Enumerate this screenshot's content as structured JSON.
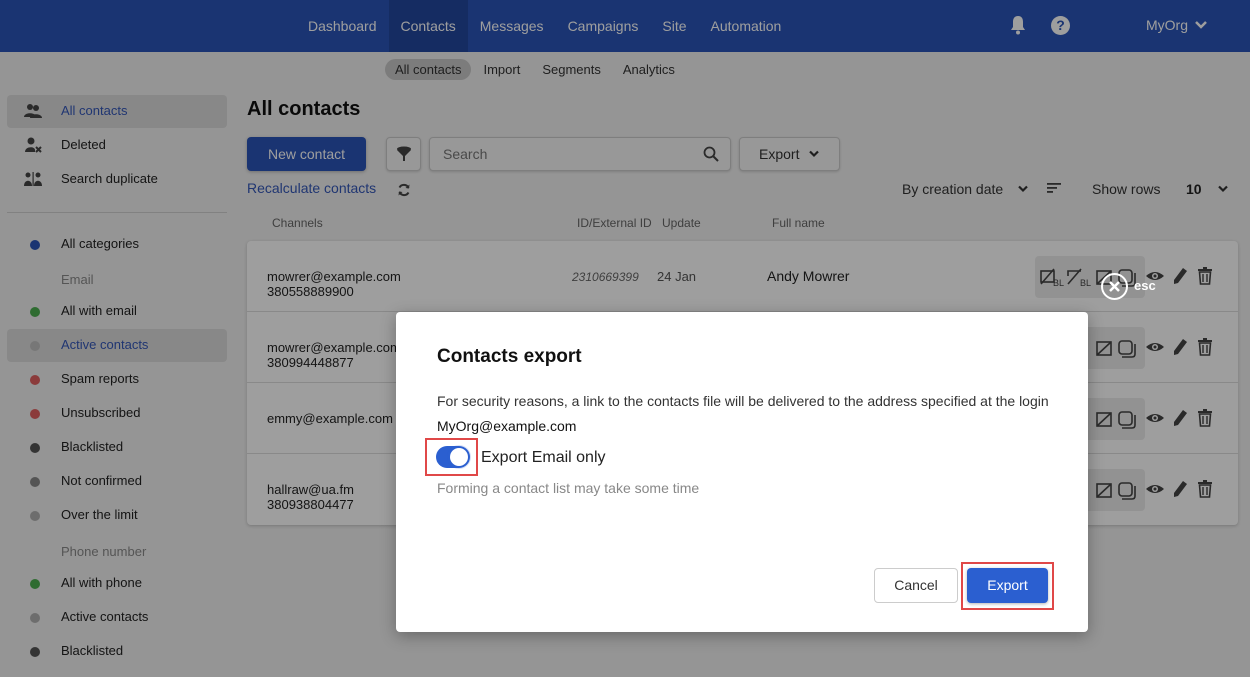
{
  "topnav": {
    "items": [
      {
        "label": "Dashboard",
        "active": false
      },
      {
        "label": "Contacts",
        "active": true
      },
      {
        "label": "Messages",
        "active": false
      },
      {
        "label": "Campaigns",
        "active": false
      },
      {
        "label": "Site",
        "active": false
      },
      {
        "label": "Automation",
        "active": false
      }
    ],
    "org": "MyOrg",
    "icons": [
      "bell-icon",
      "help-icon",
      "chevron-down-icon"
    ],
    "help_glyph": "?"
  },
  "subnav": {
    "items": [
      {
        "label": "All contacts",
        "active": true
      },
      {
        "label": "Import",
        "active": false
      },
      {
        "label": "Segments",
        "active": false
      },
      {
        "label": "Analytics",
        "active": false
      }
    ]
  },
  "sidebar": {
    "top_items": [
      {
        "label": "All contacts",
        "icon": "users-icon",
        "active": true
      },
      {
        "label": "Deleted",
        "icon": "user-deleted-icon",
        "active": false
      },
      {
        "label": "Search duplicate",
        "icon": "duplicate-users-icon",
        "active": false
      }
    ],
    "all_categories": {
      "label": "All categories",
      "color": "#2b55b8"
    },
    "email_heading": "Email",
    "email_items": [
      {
        "label": "All with email",
        "color": "#4caf50",
        "active": false
      },
      {
        "label": "Active contacts",
        "color": "#c0c0c0",
        "active": true
      },
      {
        "label": "Spam reports",
        "color": "#e06060",
        "active": false
      },
      {
        "label": "Unsubscribed",
        "color": "#e06060",
        "active": false
      },
      {
        "label": "Blacklisted",
        "color": "#555555",
        "active": false
      },
      {
        "label": "Not confirmed",
        "color": "#888888",
        "active": false
      },
      {
        "label": "Over the limit",
        "color": "#b0b0b0",
        "active": false
      }
    ],
    "phone_heading": "Phone number",
    "phone_items": [
      {
        "label": "All with phone",
        "color": "#4caf50",
        "active": false
      },
      {
        "label": "Active contacts",
        "color": "#b0b0b0",
        "active": false
      },
      {
        "label": "Blacklisted",
        "color": "#555555",
        "active": false
      }
    ]
  },
  "main": {
    "title": "All contacts",
    "new_contact": "New contact",
    "search_placeholder": "Search",
    "export": "Export",
    "recalculate": "Recalculate contacts",
    "sort_by": "By creation date",
    "show_rows_label": "Show rows",
    "show_rows_value": "10",
    "columns": [
      "Channels",
      "ID/External ID",
      "Update",
      "Full name"
    ],
    "rows": [
      {
        "email": "mowrer@example.com",
        "phone": "380558889900",
        "id": "2310669399",
        "update": "24 Jan",
        "name": "Andy Mowrer"
      },
      {
        "email": "mowrer@example.com",
        "phone": "380994448877",
        "id": "",
        "update": "",
        "name": ""
      },
      {
        "email": "emmy@example.com",
        "phone": "",
        "id": "",
        "update": "",
        "name": ""
      },
      {
        "email": "hallraw@ua.fm",
        "phone": "380938804477",
        "id": "",
        "update": "",
        "name": ""
      }
    ],
    "row_badge": "BL"
  },
  "overlay": {
    "esc_label": "esc"
  },
  "modal": {
    "title": "Contacts export",
    "text": "For security reasons, a link to the contacts file will be delivered to the address specified at the login",
    "email": "MyOrg@example.com",
    "toggle_label": "Export Email only",
    "toggle_on": true,
    "hint": "Forming a contact list may take some time",
    "cancel": "Cancel",
    "export": "Export"
  }
}
